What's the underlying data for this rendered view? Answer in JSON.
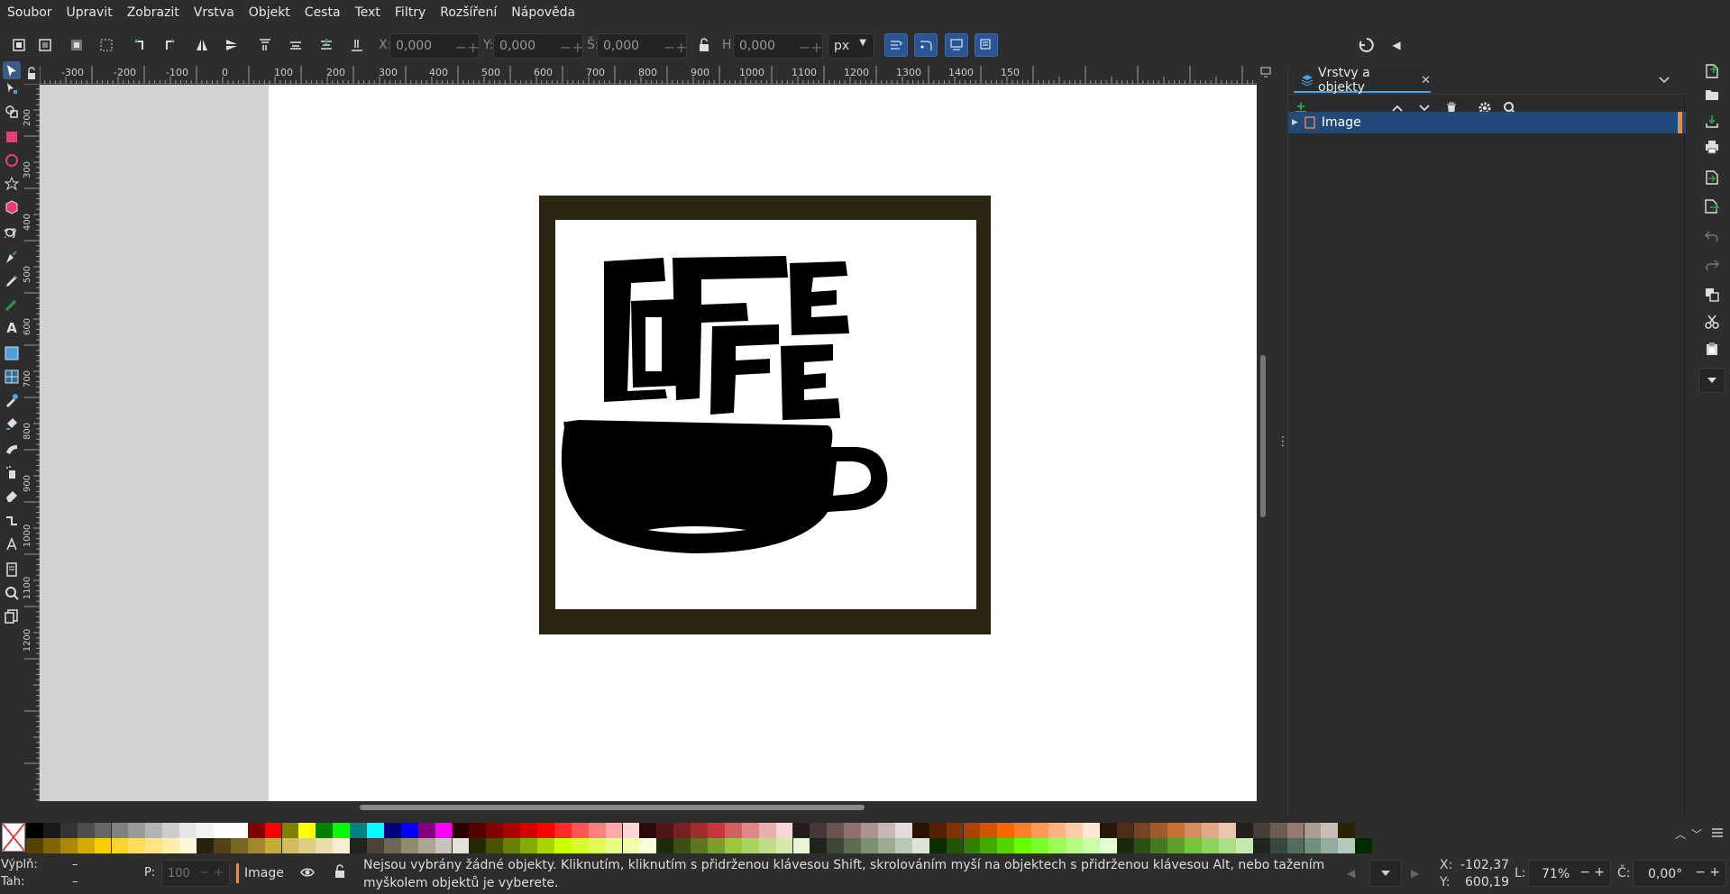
{
  "menu": [
    "Soubor",
    "Upravit",
    "Zobrazit",
    "Vrstva",
    "Objekt",
    "Cesta",
    "Text",
    "Filtry",
    "Rozšíření",
    "Nápověda"
  ],
  "toolbar": {
    "x_label": "X:",
    "x_value": "0,000",
    "y_label": "Y:",
    "y_value": "0,000",
    "w_label": "Š:",
    "w_value": "0,000",
    "h_label": "H:",
    "h_value": "0,000",
    "unit": "px"
  },
  "ruler_top_labels": [
    "-300",
    "-200",
    "-100",
    "0",
    "100",
    "200",
    "300",
    "400",
    "500",
    "600",
    "700",
    "800",
    "900",
    "1000",
    "1100",
    "1200",
    "1300",
    "1400",
    "150"
  ],
  "ruler_left_labels": [
    "200",
    "300",
    "400",
    "500",
    "600",
    "700",
    "800",
    "900",
    "1000",
    "1100",
    "1200"
  ],
  "dialog": {
    "tab_title": "Vrstvy a objekty",
    "layer_name": "Image"
  },
  "status": {
    "fill_label": "Výplň:",
    "fill_value": "–",
    "stroke_label": "Tah:",
    "stroke_value": "–",
    "opacity_label": "P:",
    "opacity_value": "100",
    "layer_name": "Image",
    "message": "Nejsou vybrány žádné objekty. Kliknutím, kliknutím s přidrženou klávesou Shift, skrolováním myší na objektech s přidrženou klávesou Alt, nebo tažením myškolem objektů je vyberete.",
    "cursor_x_label": "X:",
    "cursor_x": "-102,37",
    "cursor_y_label": "Y:",
    "cursor_y": "600,19",
    "zoom_label": "L:",
    "zoom": "71%",
    "rotate_label": "Č:",
    "rotate": "0,00°"
  },
  "colors": {
    "accent": "#2a5494",
    "layer_marker": "#f08a3c",
    "selected_row": "#214a7a",
    "frame_dark": "#2b2413"
  },
  "palette_row1": [
    "#000000",
    "#1a1a1a",
    "#333333",
    "#4d4d4d",
    "#666666",
    "#808080",
    "#999999",
    "#b3b3b3",
    "#cccccc",
    "#e6e6e6",
    "#f2f2f2",
    "#ffffff",
    "#ffffff",
    "#800000",
    "#ff0000",
    "#808000",
    "#ffff00",
    "#008000",
    "#00ff00",
    "#008080",
    "#00ffff",
    "#000080",
    "#0000ff",
    "#800080",
    "#ff00ff",
    "#2b0000",
    "#550000",
    "#800000",
    "#aa0000",
    "#d40000",
    "#ff0000",
    "#ff2a2a",
    "#ff5555",
    "#ff8080",
    "#ffaaaa",
    "#ffd5d5",
    "#280b0b",
    "#501616",
    "#782121",
    "#a02c2c",
    "#c83737",
    "#d35f5f",
    "#de8787",
    "#e9afaf",
    "#f4d7d7",
    "#241c1c",
    "#483737",
    "#6c5353",
    "#916f6f",
    "#ac9393",
    "#c8b7b7",
    "#e3dbdb",
    "#2b1100",
    "#552200",
    "#803300",
    "#aa4400",
    "#d45500",
    "#ff6600",
    "#ff7f2a",
    "#ff9955",
    "#ffb380",
    "#ffccaa",
    "#ffe6d5",
    "#28170b",
    "#502d16",
    "#784421",
    "#a05a2c",
    "#c87137",
    "#d38d5f",
    "#deaa87",
    "#e9c6af",
    "#241f1c",
    "#483e37",
    "#6c5d53",
    "#917c6f",
    "#ac9d93",
    "#c8beb7",
    "#2b2200"
  ],
  "palette_row2": [
    "#554400",
    "#806600",
    "#aa8800",
    "#d4aa00",
    "#ffcc00",
    "#ffd42a",
    "#ffdd55",
    "#ffe680",
    "#ffeeaa",
    "#fff6d5",
    "#28220b",
    "#504416",
    "#786721",
    "#a0892c",
    "#c8ab37",
    "#d3bc5f",
    "#decd87",
    "#e9ddaf",
    "#f4eed7",
    "#24221c",
    "#484537",
    "#6c6753",
    "#918a6f",
    "#aca793",
    "#c8c4b7",
    "#e3e2db",
    "#222b00",
    "#445500",
    "#668000",
    "#88aa00",
    "#aad400",
    "#ccff00",
    "#d4ff2a",
    "#ddff55",
    "#e5ff80",
    "#eeffaa",
    "#f6ffd5",
    "#1e2b0b",
    "#3c5016",
    "#5a7821",
    "#789f2c",
    "#96c837",
    "#abd35f",
    "#c0de87",
    "#d5e9af",
    "#eaf4d7",
    "#1f241c",
    "#3e4837",
    "#5d6c53",
    "#7c916f",
    "#9bac93",
    "#b9c8b7",
    "#dbe3db",
    "#112b00",
    "#225500",
    "#338000",
    "#44aa00",
    "#55d400",
    "#66ff00",
    "#7fff2a",
    "#99ff55",
    "#b3ff80",
    "#ccffaa",
    "#e5ffd5",
    "#1c280b",
    "#2d5016",
    "#447821",
    "#5aa02c",
    "#71c837",
    "#8dd35f",
    "#aade87",
    "#c6e9af",
    "#1f241c",
    "#37483e",
    "#536c5d",
    "#6f917c",
    "#93ac9d",
    "#b7c8be",
    "#002b00"
  ]
}
